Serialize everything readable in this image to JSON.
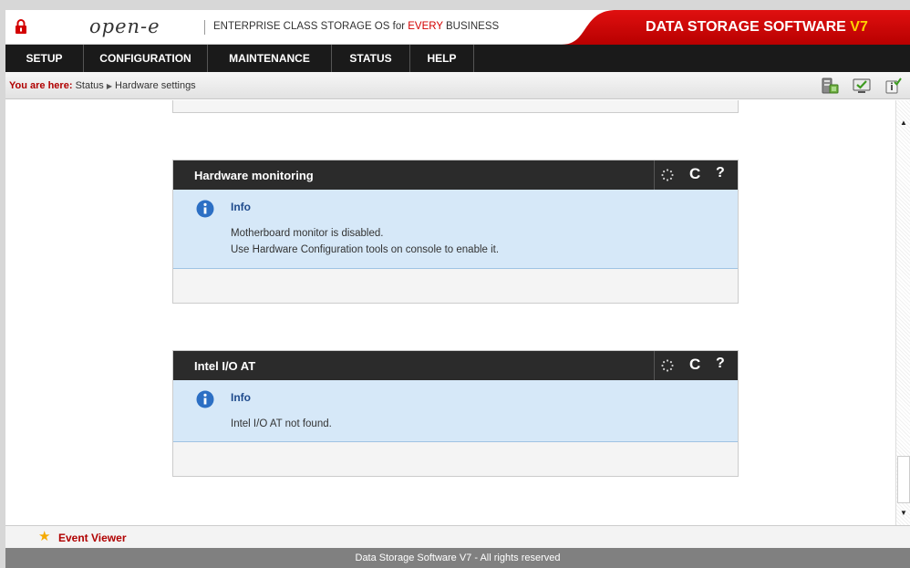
{
  "header": {
    "logo": "open-e",
    "tagline_pre": "ENTERPRISE CLASS STORAGE OS for ",
    "tagline_em": "EVERY",
    "tagline_post": " BUSINESS",
    "brand": "DATA STORAGE SOFTWARE ",
    "brand_version": "V7",
    "accent_color": "#d30000"
  },
  "menu": {
    "items": [
      {
        "label": "SETUP"
      },
      {
        "label": "CONFIGURATION"
      },
      {
        "label": "MAINTENANCE"
      },
      {
        "label": "STATUS"
      },
      {
        "label": "HELP"
      }
    ]
  },
  "breadcrumb": {
    "label": "You are here:",
    "items": [
      "Status",
      "Hardware settings"
    ],
    "icons": [
      "storage-status-icon",
      "monitor-check-icon",
      "info-check-icon"
    ]
  },
  "panels": [
    {
      "title": "Hardware monitoring",
      "info_title": "Info",
      "lines": [
        "Motherboard monitor is disabled.",
        "Use Hardware Configuration tools on console to enable it."
      ]
    },
    {
      "title": "Intel I/O AT",
      "info_title": "Info",
      "lines": [
        "Intel I/O AT not found."
      ]
    }
  ],
  "panel_controls": {
    "refresh_glyph": "C",
    "help_glyph": "?"
  },
  "event_viewer": {
    "label": "Event Viewer"
  },
  "footer": {
    "text": "Data Storage Software V7 - All rights reserved"
  }
}
